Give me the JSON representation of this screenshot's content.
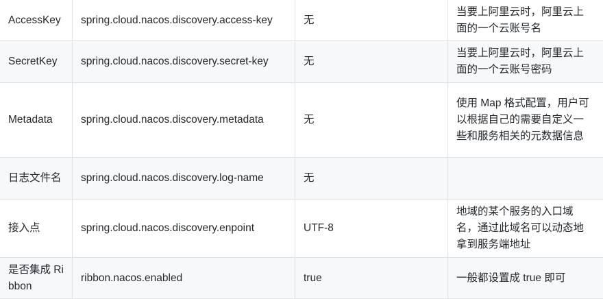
{
  "table": {
    "rows": [
      {
        "name": "AccessKey",
        "key": "spring.cloud.nacos.discovery.access-key",
        "default": "无",
        "desc": "当要上阿里云时，阿里云上面的一个云账号名"
      },
      {
        "name": "SecretKey",
        "key": "spring.cloud.nacos.discovery.secret-key",
        "default": "无",
        "desc": "当要上阿里云时，阿里云上面的一个云账号密码"
      },
      {
        "name": "Metadata",
        "key": "spring.cloud.nacos.discovery.metadata",
        "default": "无",
        "desc": "使用 Map 格式配置，用户可以根据自己的需要自定义一些和服务相关的元数据信息"
      },
      {
        "name": "日志文件名",
        "key": "spring.cloud.nacos.discovery.log-name",
        "default": "无",
        "desc": ""
      },
      {
        "name": "接入点",
        "key": "spring.cloud.nacos.discovery.enpoint",
        "default": "UTF-8",
        "desc": "地域的某个服务的入口域名，通过此域名可以动态地拿到服务端地址"
      },
      {
        "name": "是否集成 Ribbon",
        "key": "ribbon.nacos.enabled",
        "default": "true",
        "desc": "一般都设置成 true 即可"
      }
    ]
  }
}
